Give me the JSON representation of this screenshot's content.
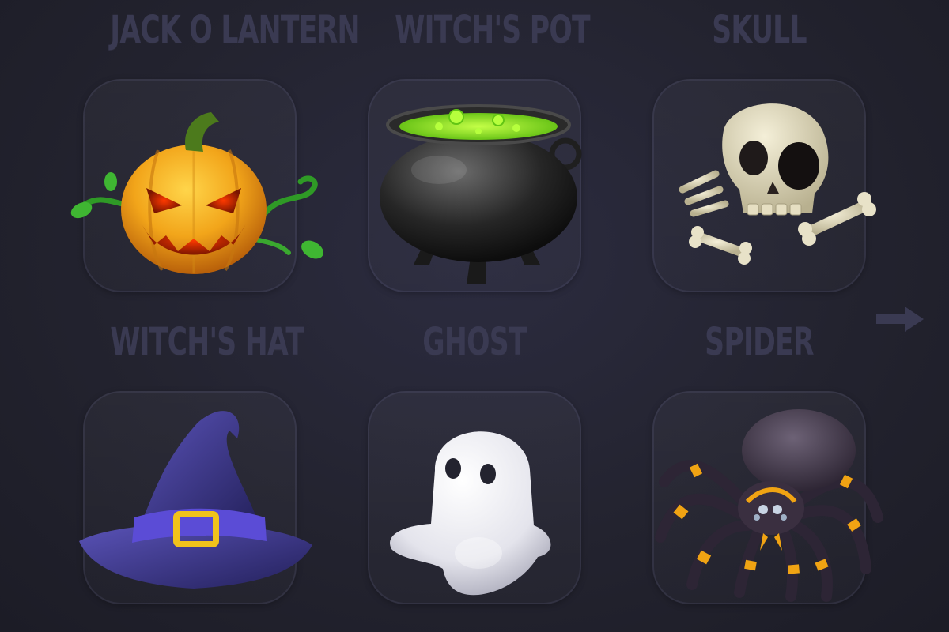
{
  "icons": [
    {
      "label": "JACK O LANTERN",
      "icon": "jack-o-lantern-icon"
    },
    {
      "label": "WITCH'S POT",
      "icon": "witch-pot-icon"
    },
    {
      "label": "SKULL",
      "icon": "skull-icon"
    },
    {
      "label": "WITCH'S HAT",
      "icon": "witch-hat-icon"
    },
    {
      "label": "GHOST",
      "icon": "ghost-icon"
    },
    {
      "label": "SPIDER",
      "icon": "spider-icon"
    }
  ],
  "colors": {
    "background": "#23232f",
    "label": "#3a3a52",
    "tile_border": "#3b3b55",
    "pumpkin": "#f2a51a",
    "potion": "#8fe21f",
    "bone": "#e8e2c8",
    "hat": "#3a3378",
    "buckle": "#f1c21b",
    "ghost": "#f2f2f6",
    "spider_band": "#f0a313"
  },
  "navigation": {
    "next_icon": "arrow-right-icon"
  }
}
